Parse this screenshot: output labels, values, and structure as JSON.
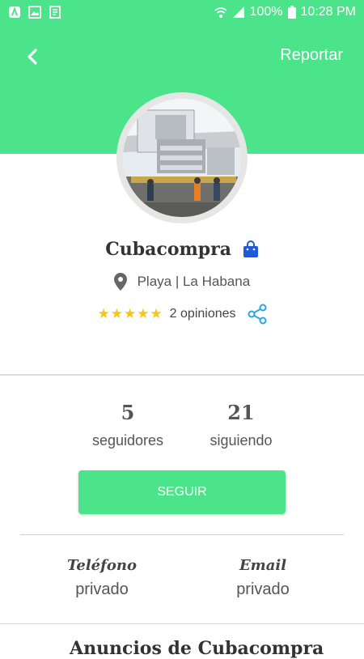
{
  "status_bar": {
    "battery": "100%",
    "time": "10:28 PM"
  },
  "header": {
    "report_label": "Reportar"
  },
  "profile": {
    "name": "Cubacompra",
    "location": "Playa | La Habana",
    "rating_stars": 5,
    "stars_display": "★★★★★",
    "reviews_label": "2 opiniones"
  },
  "stats": {
    "followers_count": "5",
    "followers_label": "seguidores",
    "following_count": "21",
    "following_label": "siguiendo"
  },
  "follow_button_label": "SEGUIR",
  "contact": {
    "phone_label": "Teléfono",
    "phone_value": "privado",
    "email_label": "Email",
    "email_value": "privado"
  },
  "next_section_title": "Anuncios de Cubacompra",
  "colors": {
    "brand_green": "#4ce48b",
    "star_yellow": "#f5c518",
    "bag_blue": "#1e5bd8",
    "share_blue": "#29a8e0"
  },
  "icons": {
    "back": "back-arrow-icon",
    "bag": "shopping-bag-icon",
    "pin": "location-pin-icon",
    "share": "share-icon"
  }
}
